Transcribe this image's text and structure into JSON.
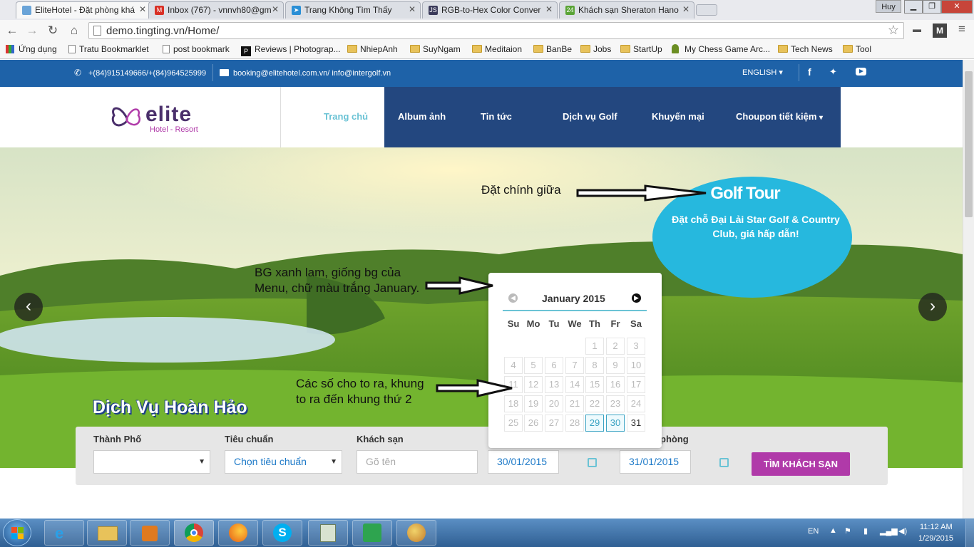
{
  "browser": {
    "tabs": [
      {
        "title": "EliteHotel - Đặt phòng khá",
        "icon": "page-icon",
        "color": "#6aa4d8"
      },
      {
        "title": "Inbox (767) - vnnvh80@gm",
        "icon": "gmail-icon",
        "color": "#d93025"
      },
      {
        "title": "Trang Không Tìm Thấy",
        "icon": "paper-plane-icon",
        "color": "#2a8fd6"
      },
      {
        "title": "RGB-to-Hex Color Conver",
        "icon": "js-icon",
        "color": "#3a3a5a"
      },
      {
        "title": "Khách sạn Sheraton Hano",
        "icon": "24h-icon",
        "color": "#5aa436"
      }
    ],
    "user": "Huy",
    "address": "demo.tingting.vn/Home/",
    "bookmarks": [
      {
        "label": "Ứng dụng",
        "icon": "apps-icon"
      },
      {
        "label": "Tratu Bookmarklet",
        "icon": "page-icon"
      },
      {
        "label": "post bookmark",
        "icon": "page-icon"
      },
      {
        "label": "Reviews | Photograp...",
        "icon": "p-icon"
      },
      {
        "label": "NhiepAnh",
        "icon": "folder-icon"
      },
      {
        "label": "SuyNgam",
        "icon": "folder-icon"
      },
      {
        "label": "Meditaion",
        "icon": "folder-icon"
      },
      {
        "label": "BanBe",
        "icon": "folder-icon"
      },
      {
        "label": "Jobs",
        "icon": "folder-icon"
      },
      {
        "label": "StartUp",
        "icon": "folder-icon"
      },
      {
        "label": "My Chess Game Arc...",
        "icon": "chess-icon"
      },
      {
        "label": "Tech News",
        "icon": "folder-icon"
      },
      {
        "label": "Tool",
        "icon": "folder-icon"
      }
    ]
  },
  "site": {
    "phone": "+(84)915149666/+(84)964525999",
    "email": "booking@elitehotel.com.vn/ info@intergolf.vn",
    "language": "ENGLISH",
    "logo": {
      "name": "elite",
      "tagline": "Hotel - Resort"
    },
    "nav": [
      "Trang chủ",
      "Album ảnh",
      "Tin tức",
      "Dịch vụ Golf",
      "Khuyến mại",
      "Choupon tiết kiệm"
    ],
    "brand_color": "#1e62a8",
    "nav_color": "#23477f",
    "active_nav_color": "#6bc3d5"
  },
  "hero": {
    "tagline": "Dịch Vụ Hoàn Hảo",
    "badge_title": "Golf Tour",
    "badge_text": "Đặt chỗ Đại Lải Star Golf & Country Club, giá hấp dẫn!"
  },
  "annotations": {
    "center": "Đặt chính giữa",
    "blue_bg_line1": "BG xanh lam, giống bg của",
    "blue_bg_line2": "Menu, chữ màu trắng January.",
    "bigger_line1": "Các số cho to ra, khung",
    "bigger_line2": "to ra đến khung thứ 2"
  },
  "search": {
    "city_label": "Thành Phố",
    "standard_label": "Tiêu chuẩn",
    "standard_value": "Chọn tiêu chuẩn",
    "hotel_label": "Khách sạn",
    "hotel_placeholder": "Gõ tên",
    "checkin_value": "30/01/2015",
    "checkout_label_visible": "phòng",
    "checkout_value": "31/01/2015",
    "button": "TÌM KHÁCH SẠN",
    "button_color": "#b03aa9"
  },
  "calendar": {
    "month": "January 2015",
    "weekdays": [
      "Su",
      "Mo",
      "Tu",
      "We",
      "Th",
      "Fr",
      "Sa"
    ],
    "weeks": [
      [
        "",
        "",
        "",
        "",
        "1",
        "2",
        "3"
      ],
      [
        "4",
        "5",
        "6",
        "7",
        "8",
        "9",
        "10"
      ],
      [
        "11",
        "12",
        "13",
        "14",
        "15",
        "16",
        "17"
      ],
      [
        "18",
        "19",
        "20",
        "21",
        "22",
        "23",
        "24"
      ],
      [
        "25",
        "26",
        "27",
        "28",
        "29",
        "30",
        "31"
      ]
    ],
    "selected": [
      "29",
      "30"
    ],
    "current": [
      "31"
    ]
  },
  "taskbar": {
    "lang": "EN",
    "time": "11:12 AM",
    "date": "1/29/2015",
    "apps": [
      "ie-icon",
      "explorer-icon",
      "media-player-icon",
      "chrome-icon",
      "firefox-icon",
      "skype-icon",
      "calculator-icon",
      "visual-studio-icon",
      "paint-icon"
    ]
  }
}
